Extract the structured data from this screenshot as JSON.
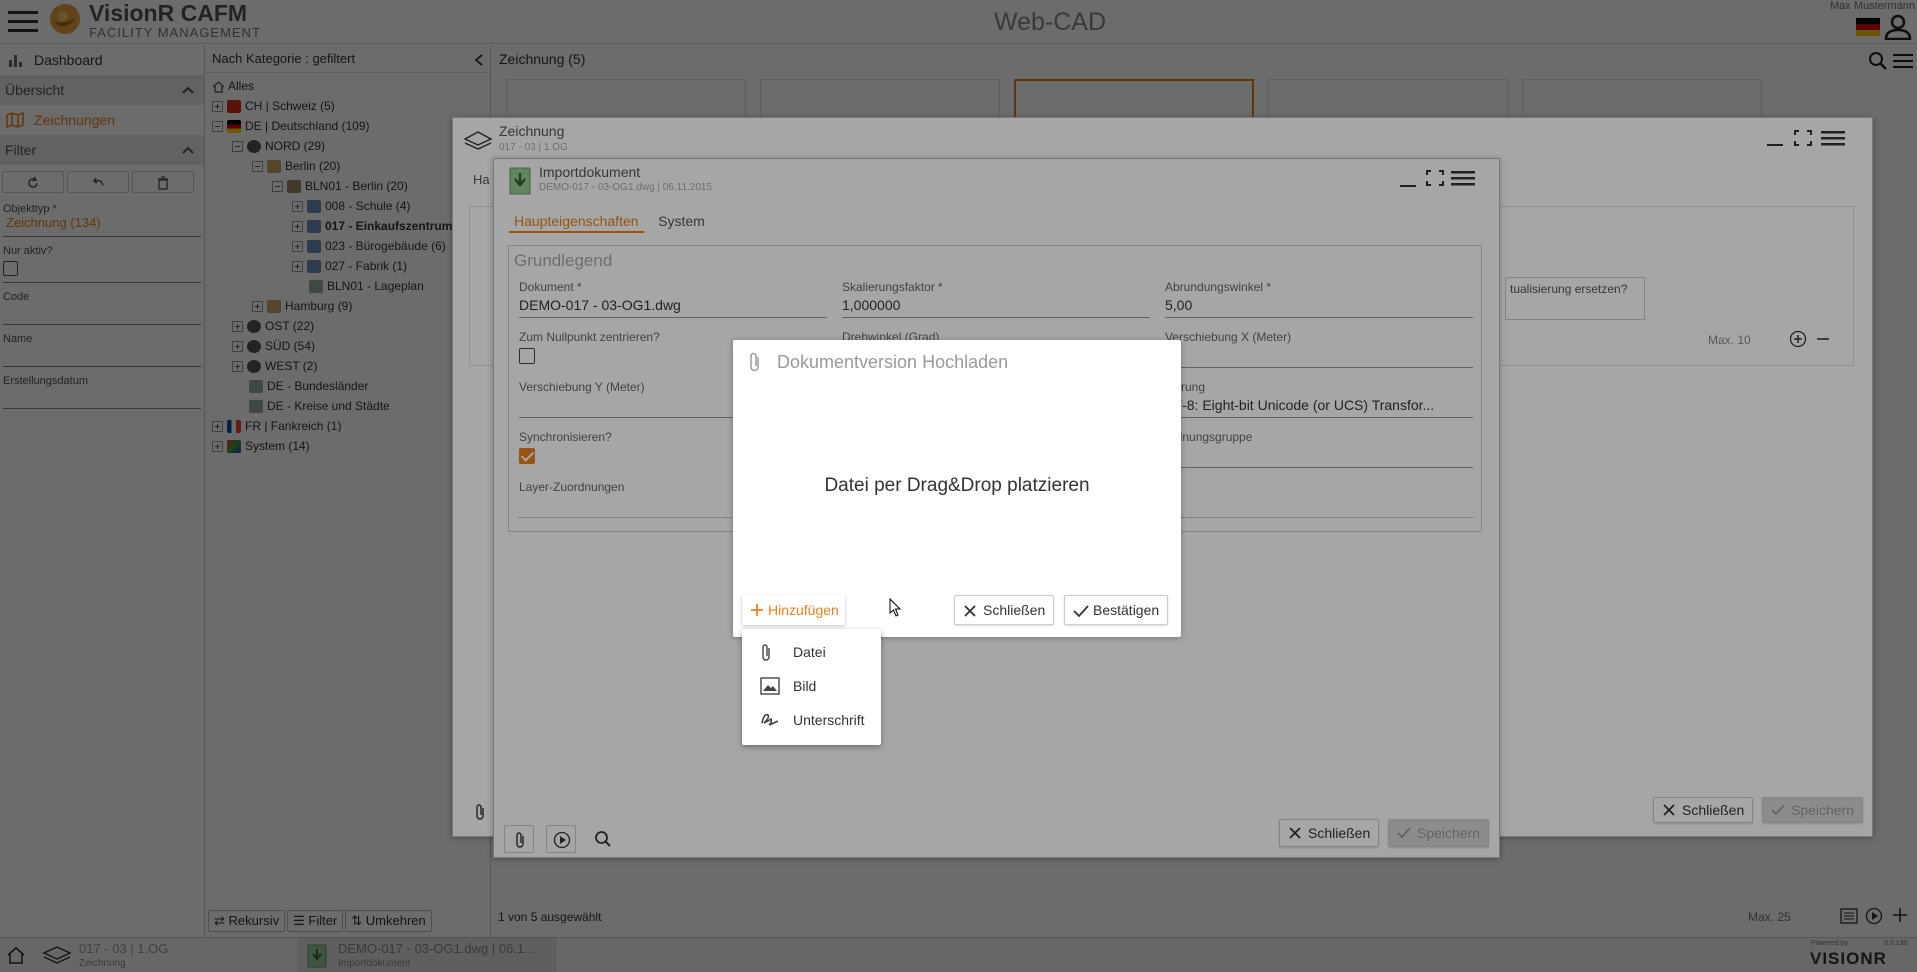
{
  "app": {
    "brand": "VisionR CAFM",
    "brand_sub": "FACILITY MANAGEMENT",
    "title": "Web-CAD",
    "user": "Max Mustermann"
  },
  "leftnav": {
    "dashboard": "Dashboard",
    "overview": "Übersicht",
    "drawings": "Zeichnungen",
    "filter": "Filter",
    "filters": [
      {
        "label": "Objekttyp *",
        "value": "Zeichnung (134)"
      },
      {
        "label": "Nur aktiv?",
        "value": ""
      },
      {
        "label": "Code",
        "value": ""
      },
      {
        "label": "Name",
        "value": ""
      },
      {
        "label": "Erstellungsdatum",
        "value": ""
      }
    ]
  },
  "tree": {
    "header": "Nach Kategorie : gefiltert",
    "nodes": [
      {
        "label": "Alles"
      },
      {
        "label": "CH | Schweiz (5)"
      },
      {
        "label": "DE | Deutschland (109)"
      },
      {
        "label": "NORD (29)"
      },
      {
        "label": "Berlin (20)"
      },
      {
        "label": "BLN01 - Berlin (20)"
      },
      {
        "label": "008 - Schule (4)"
      },
      {
        "label": "017 - Einkaufszentrum"
      },
      {
        "label": "023 - Bürogebäude (6)"
      },
      {
        "label": "027 - Fabrik (1)"
      },
      {
        "label": "BLN01 - Lageplan"
      },
      {
        "label": "Hamburg (9)"
      },
      {
        "label": "OST (22)"
      },
      {
        "label": "SÜD (54)"
      },
      {
        "label": "WEST (2)"
      },
      {
        "label": "DE - Bundesländer"
      },
      {
        "label": "DE - Kreise und Städte"
      },
      {
        "label": "FR | Fankreich (1)"
      },
      {
        "label": "System (14)"
      }
    ],
    "buttons": {
      "recursive": "Rekursiv",
      "filter": "Filter",
      "invert": "Umkehren"
    }
  },
  "main": {
    "header": "Zeichnung (5)",
    "status": "1 von 5 ausgewählt",
    "max": "Max. 25"
  },
  "win_zeichnung": {
    "title": "Zeichnung",
    "sub": "017 - 03 | 1.OG",
    "tab1": "Ha",
    "close": "Schließen",
    "save": "Speichern",
    "col_update": "tualisierung ersetzen?",
    "max": "Max. 10"
  },
  "win_import": {
    "title": "Importdokument",
    "sub": "DEMO-017 - 03-OG1.dwg | 06.11.2015",
    "tabs": [
      "Haupteigenschaften",
      "System"
    ],
    "section": "Grundlegend",
    "fields": {
      "doc_label": "Dokument *",
      "doc_value": "DEMO-017 - 03-OG1.dwg",
      "scale_label": "Skalierungsfaktor *",
      "scale_value": "1,000000",
      "round_label": "Abrundungswinkel *",
      "round_value": "5,00",
      "center_label": "Zum Nullpunkt zentrieren?",
      "rot_label": "Drehwinkel (Grad)",
      "shiftx_label": "Verschiebung X (Meter)",
      "shifty_label": "Verschiebung Y (Meter)",
      "enc_label": "dierung",
      "enc_value": "TF-8: Eight-bit Unicode (or UCS) Transfor...",
      "sync_label": "Synchronisieren?",
      "group_label": "ordnungsgruppe",
      "layer_label": "Layer-Zuordnungen"
    },
    "close": "Schließen",
    "save": "Speichern"
  },
  "dialog": {
    "title": "Dokumentversion Hochladen",
    "drop": "Datei per Drag&Drop platzieren",
    "add": "Hinzufügen",
    "close": "Schließen",
    "confirm": "Bestätigen",
    "menu": [
      "Datei",
      "Bild",
      "Unterschrift"
    ]
  },
  "taskbar": {
    "t1_title": "017 - 03 | 1.OG",
    "t1_sub": "Zeichnung",
    "t2_title": "DEMO-017 - 03-OG1.dwg | 06.1...",
    "t2_sub": "Importdokument",
    "powered": "Powered by",
    "version": "9.0.130",
    "logo": "VISIONR"
  },
  "colors": {
    "accent": "#e8821e"
  }
}
